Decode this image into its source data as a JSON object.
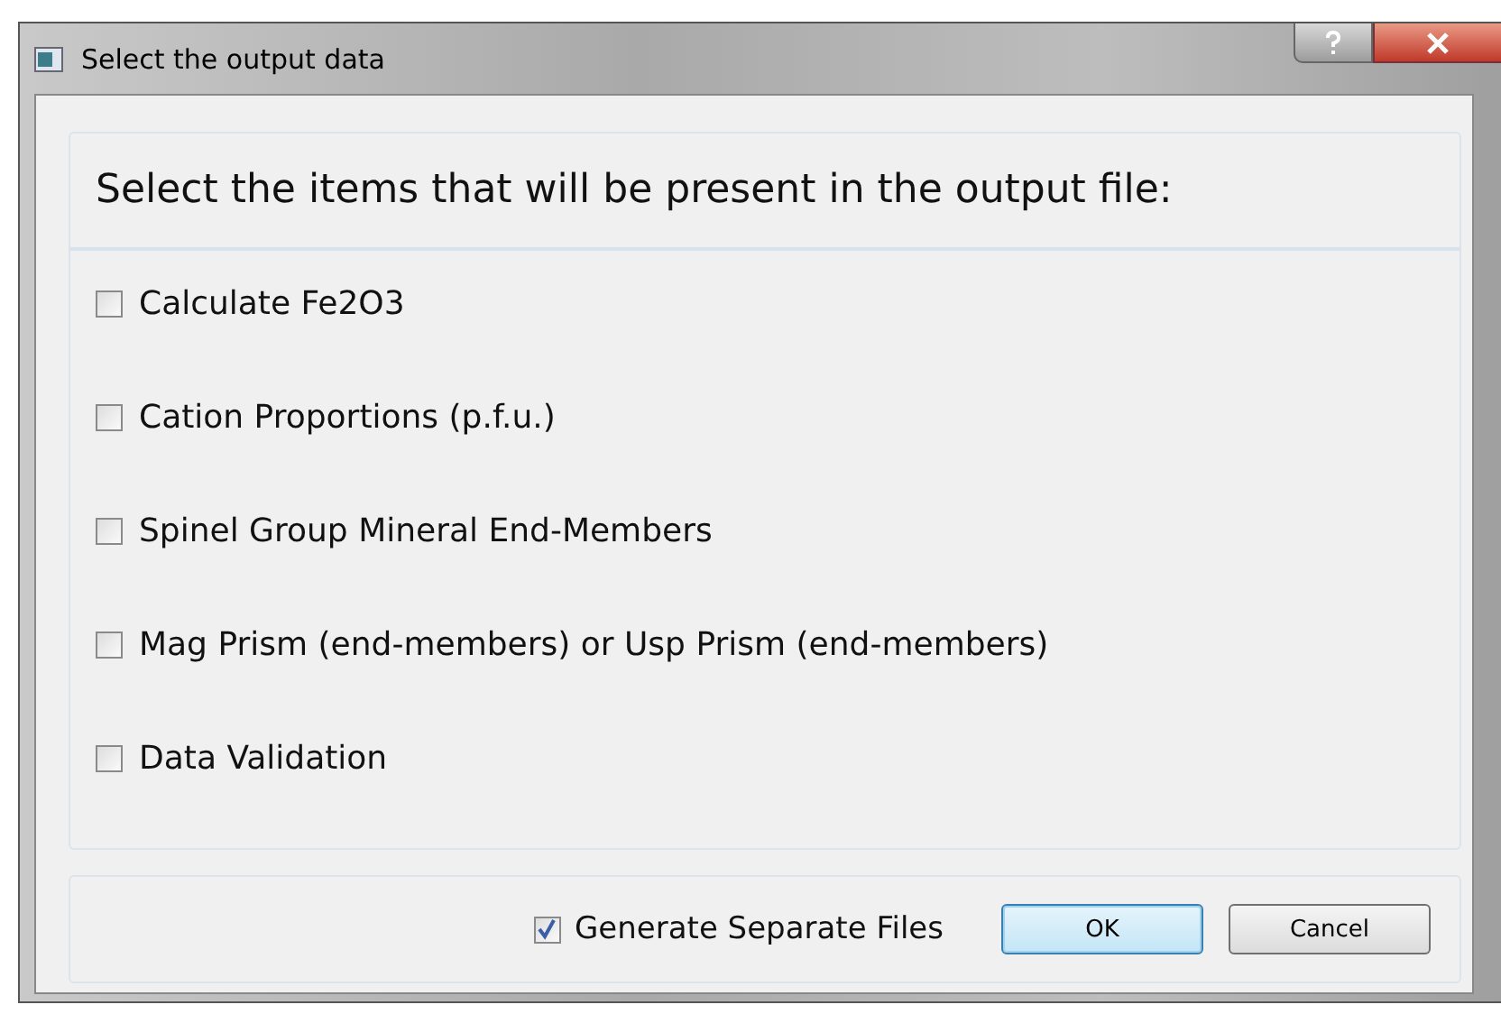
{
  "window": {
    "title": "Select the output data"
  },
  "heading": "Select the items that will be present in the output file:",
  "items": [
    {
      "label": "Calculate Fe2O3",
      "checked": false
    },
    {
      "label": "Cation Proportions (p.f.u.)",
      "checked": false
    },
    {
      "label": "Spinel Group Mineral End-Members",
      "checked": false
    },
    {
      "label": "Mag Prism (end-members) or Usp Prism (end-members)",
      "checked": false
    },
    {
      "label": "Data Validation",
      "checked": false
    }
  ],
  "separate_files": {
    "label": "Generate Separate Files",
    "checked": true
  },
  "buttons": [
    {
      "label": "OK",
      "kind": "default"
    },
    {
      "label": "Cancel",
      "kind": "normal"
    }
  ]
}
